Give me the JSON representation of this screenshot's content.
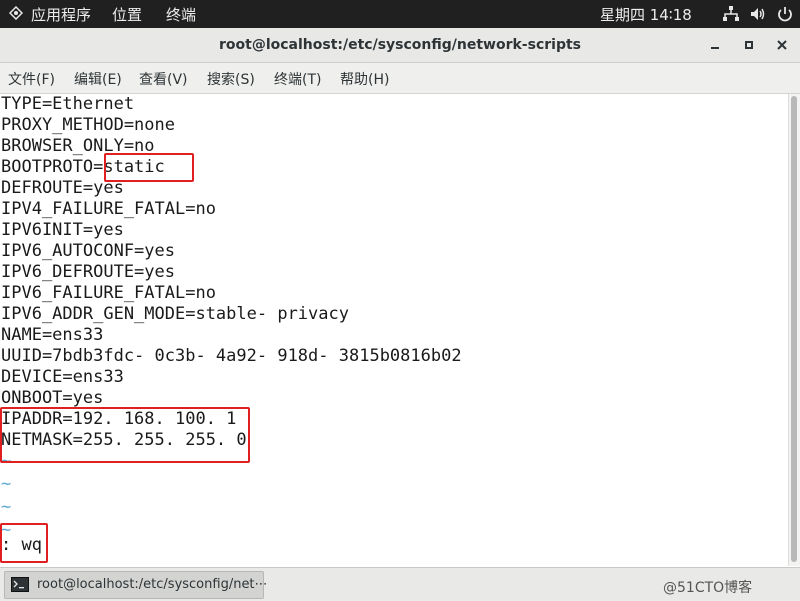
{
  "topbar": {
    "apps": "应用程序",
    "places": "位置",
    "terminal": "终端",
    "clock": "星期四 14∶18",
    "icons": [
      "network-icon",
      "volume-icon",
      "power-icon"
    ]
  },
  "window": {
    "title": "root@localhost:/etc/sysconfig/network-scripts"
  },
  "menu": {
    "file": "文件(F)",
    "edit": "编辑(E)",
    "view": "查看(V)",
    "search": "搜索(S)",
    "terminal": "终端(T)",
    "help": "帮助(H)"
  },
  "terminal": {
    "lines": [
      "TYPE=Ethernet",
      "PROXY_METHOD=none",
      "BROWSER_ONLY=no",
      "BOOTPROTO=static",
      "DEFROUTE=yes",
      "IPV4_FAILURE_FATAL=no",
      "IPV6INIT=yes",
      "IPV6_AUTOCONF=yes",
      "IPV6_DEFROUTE=yes",
      "IPV6_FAILURE_FATAL=no",
      "IPV6_ADDR_GEN_MODE=stable- privacy",
      "NAME=ens33",
      "UUID=7bdb3fdc- 0c3b- 4a92- 918d- 3815b0816b02",
      "DEVICE=ens33",
      "ONBOOT=yes",
      "IPADDR=192. 168. 100. 1",
      "NETMASK=255. 255. 255. 0"
    ],
    "tildes": [
      "~",
      "~",
      "~",
      "~"
    ],
    "command": ": wq"
  },
  "taskbar": {
    "entry": "root@localhost:/etc/sysconfig/net⋯"
  },
  "watermark": "@51CTO博客",
  "colors": {
    "highlight": "#e02020",
    "tilde": "#5fa8d3",
    "topbar": "#202020"
  }
}
